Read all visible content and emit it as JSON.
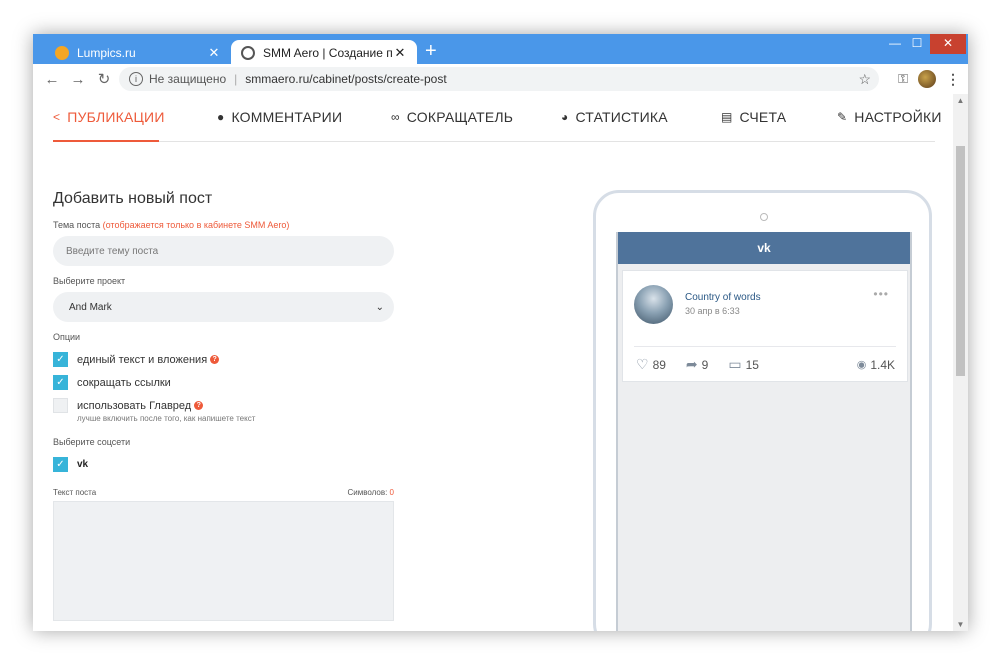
{
  "browser": {
    "tabs": [
      {
        "title": "Lumpics.ru",
        "close": "✕",
        "favicon_color": "#f5a623"
      },
      {
        "title": "SMM Aero | Создание поста",
        "close": "✕",
        "favicon_color": "#555555"
      }
    ],
    "new_tab": "+",
    "window_controls": {
      "minimize": "—",
      "maximize": "☐",
      "close": "✕"
    },
    "nav": {
      "back": "←",
      "forward": "→",
      "reload": "↻"
    },
    "security": "Не защищено",
    "url": "smmaero.ru/cabinet/posts/create-post"
  },
  "nav": {
    "items": [
      {
        "label": "ПУБЛИКАЦИИ",
        "icon": "share-icon",
        "glyph": "⋖"
      },
      {
        "label": "КОММЕНТАРИИ",
        "icon": "comments-icon",
        "glyph": "💬"
      },
      {
        "label": "СОКРАЩАТЕЛЬ",
        "icon": "link-icon",
        "glyph": "🔗"
      },
      {
        "label": "СТАТИСТИКА",
        "icon": "pie-chart-icon",
        "glyph": "◕"
      },
      {
        "label": "СЧЕТА",
        "icon": "document-icon",
        "glyph": "▤"
      },
      {
        "label": "НАСТРОЙКИ",
        "icon": "wrench-icon",
        "glyph": "🔧"
      }
    ],
    "active_color": "#ee5a3a"
  },
  "form": {
    "title": "Добавить новый пост",
    "topic_label": "Тема поста",
    "topic_note": "(отображается только в кабинете SMM Aero)",
    "topic_placeholder": "Введите тему поста",
    "project_label": "Выберите проект",
    "project_value": "And Mark",
    "options_label": "Опции",
    "options": [
      {
        "label": "единый текст и вложения",
        "checked": true,
        "help": "?"
      },
      {
        "label": "сокращать ссылки",
        "checked": true
      },
      {
        "label": "использовать Главред",
        "checked": false,
        "help": "?",
        "hint": "лучше включить после того, как напишете текст"
      }
    ],
    "social_label": "Выберите соцсети",
    "social_vk": "vk",
    "text_label": "Текст поста",
    "symbols_label": "Символов:",
    "symbols_count": "0"
  },
  "preview": {
    "vk_logo": "vk",
    "post": {
      "author": "Country of words",
      "date": "30 апр в 6:33",
      "more": "•••",
      "likes": "89",
      "shares": "9",
      "comments": "15",
      "views": "1.4K"
    }
  }
}
